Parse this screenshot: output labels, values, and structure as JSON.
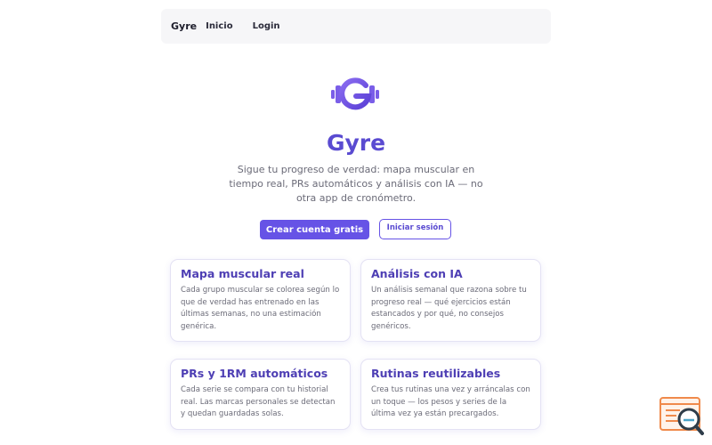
{
  "navbar": {
    "brand": "Gyre",
    "links": [
      "Inicio",
      "Login"
    ]
  },
  "hero": {
    "logo_icon": "gyre-dumbbell-logo-icon",
    "title": "Gyre",
    "subtitle": "Sigue tu progreso de verdad: mapa muscular en tiempo real, PRs automáticos y análisis con IA — no otra app de cronómetro.",
    "primary_button": "Crear cuenta gratis",
    "secondary_button": "Iniciar sesión"
  },
  "features": [
    {
      "title": "Mapa muscular real",
      "text": "Cada grupo muscular se colorea según lo que de verdad has entrenado en las últimas semanas, no una estimación genérica."
    },
    {
      "title": "Análisis con IA",
      "text": "Un análisis semanal que razona sobre tu progreso real — qué ejercicios están estancados y por qué, no consejos genéricos."
    },
    {
      "title": "PRs y 1RM automáticos",
      "text": "Cada serie se compara con tu historial real. Las marcas personales se detectan y quedan guardadas solas."
    },
    {
      "title": "Rutinas reutilizables",
      "text": "Crea tus rutinas una vez y arráncalas con un toque — los pesos y series de la última vez ya están precargados."
    }
  ],
  "colors": {
    "accent": "#6653e6",
    "title": "#5a4bd1",
    "card_title": "#4e3fb4",
    "widget": "#f08a4b"
  },
  "help_widget_icon": "search-help-icon"
}
